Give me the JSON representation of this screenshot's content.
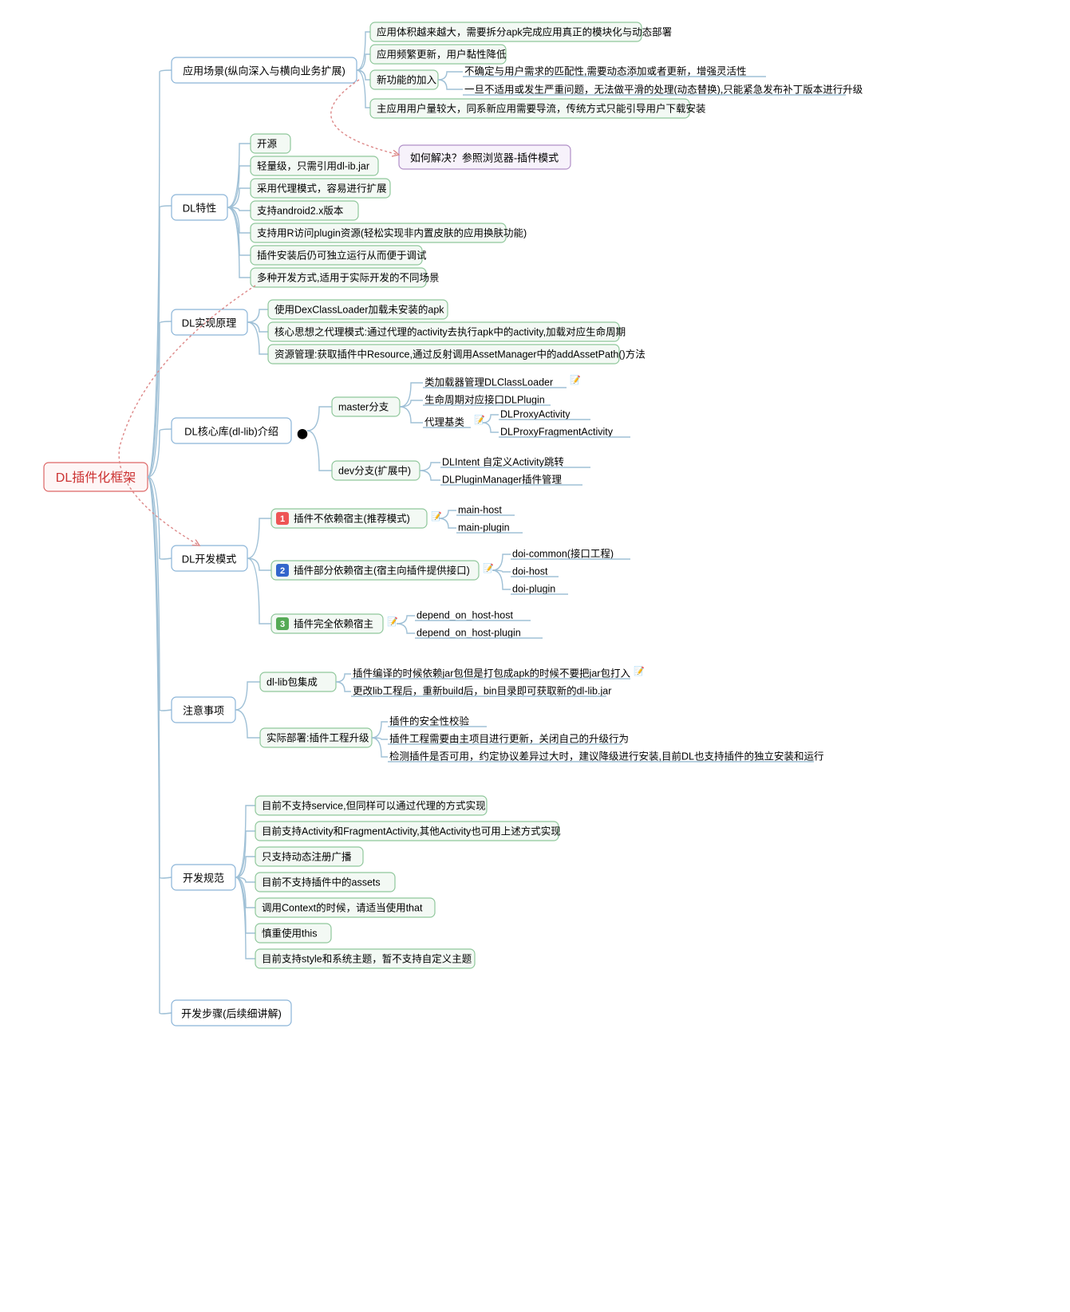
{
  "root": "DL插件化框架",
  "nodes": {
    "scene": "应用场景(纵向深入与横向业务扩展)",
    "scene_c1": "应用体积越来越大，需要拆分apk完成应用真正的模块化与动态部署",
    "scene_c2": "应用频繁更新，用户黏性降低",
    "scene_c3": "新功能的加入",
    "scene_c3a": "不确定与用户需求的匹配性,需要动态添加或者更新，增强灵活性",
    "scene_c3b": "一旦不适用或发生严重问题，无法做平滑的处理(动态替换),只能紧急发布补丁版本进行升级",
    "scene_c4": "主应用用户量较大，同系新应用需要导流，传统方式只能引导用户下载安装",
    "solution": "如何解决？参照浏览器-插件模式",
    "feat": "DL特性",
    "feat_c1": "开源",
    "feat_c2": "轻量级，只需引用dl-ib.jar",
    "feat_c3": "采用代理模式，容易进行扩展",
    "feat_c4": "支持android2.x版本",
    "feat_c5": "支持用R访问plugin资源(轻松实现非内置皮肤的应用换肤功能)",
    "feat_c6": "插件安装后仍可独立运行从而便于调试",
    "feat_c7": "多种开发方式,适用于实际开发的不同场景",
    "impl": "DL实现原理",
    "impl_c1": "使用DexClassLoader加载未安装的apk",
    "impl_c2": "核心思想之代理模式:通过代理的activity去执行apk中的activity,加载对应生命周期",
    "impl_c3": "资源管理:获取插件中Resource,通过反射调用AssetManager中的addAssetPath()方法",
    "core": "DL核心库(dl-lib)介绍",
    "core_master": "master分支",
    "core_m1": "类加载器管理DLClassLoader",
    "core_m2": "生命周期对应接口DLPlugin",
    "core_m3": "代理基类",
    "core_m3a": "DLProxyActivity",
    "core_m3b": "DLProxyFragmentActivity",
    "core_dev": "dev分支(扩展中)",
    "core_d1": "DLIntent 自定义Activity跳转",
    "core_d2": "DLPluginManager插件管理",
    "mode": "DL开发模式",
    "mode_1": "插件不依赖宿主(推荐模式)",
    "mode_1a": "main-host",
    "mode_1b": "main-plugin",
    "mode_2": "插件部分依赖宿主(宿主向插件提供接口)",
    "mode_2a": "doi-common(接口工程)",
    "mode_2b": "doi-host",
    "mode_2c": "doi-plugin",
    "mode_3": "插件完全依赖宿主",
    "mode_3a": "depend_on_host-host",
    "mode_3b": "depend_on_host-plugin",
    "note": "注意事项",
    "note_lib": "dl-lib包集成",
    "note_lib1": "插件编译的时候依赖jar包但是打包成apk的时候不要把jar包打入",
    "note_lib2": "更改lib工程后，重新build后，bin目录即可获取新的dl-lib.jar",
    "note_dep": "实际部署:插件工程升级",
    "note_dep1": "插件的安全性校验",
    "note_dep2": "插件工程需要由主项目进行更新，关闭自己的升级行为",
    "note_dep3": "检测插件是否可用，约定协议差异过大时，建议降级进行安装,目前DL也支持插件的独立安装和运行",
    "spec": "开发规范",
    "spec_c1": "目前不支持service,但同样可以通过代理的方式实现",
    "spec_c2": "目前支持Activity和FragmentActivity,其他Activity也可用上述方式实现",
    "spec_c3": "只支持动态注册广播",
    "spec_c4": "目前不支持插件中的assets",
    "spec_c5": "调用Context的时候，请适当使用that",
    "spec_c6": "慎重使用this",
    "spec_c7": "目前支持style和系统主题，暂不支持自定义主题",
    "steps": "开发步骤(后续细讲解)"
  },
  "badges": {
    "b1": "1",
    "b2": "2",
    "b3": "3"
  },
  "icons": {
    "edit": "📝",
    "github": "⬤"
  }
}
